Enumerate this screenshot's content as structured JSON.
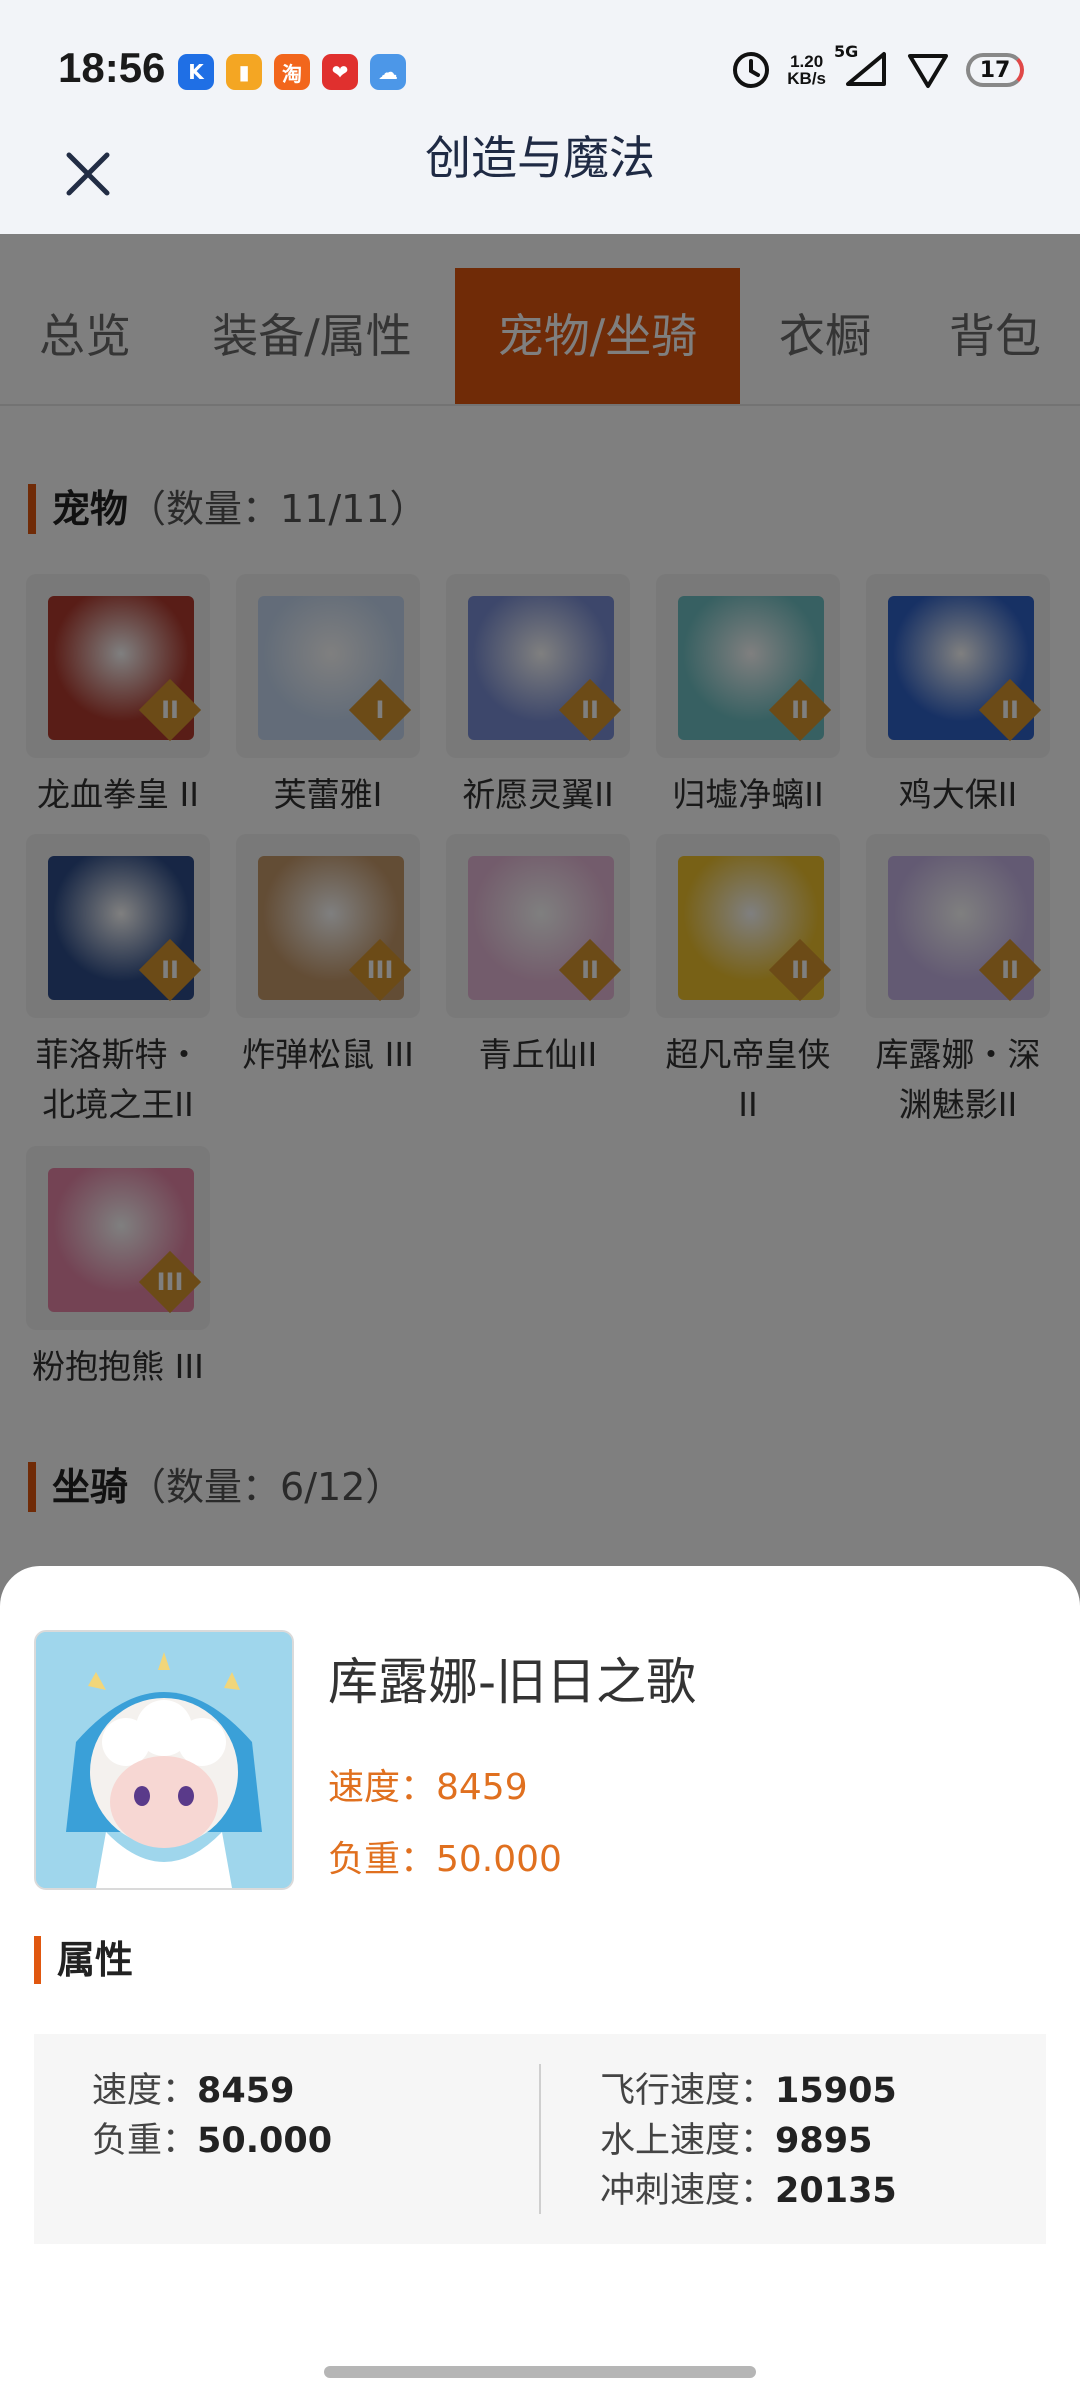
{
  "status_bar": {
    "time": "18:56",
    "app_icons": [
      {
        "name": "k-app-icon",
        "glyph": "K",
        "color": "#1f6fe5"
      },
      {
        "name": "notes-app-icon",
        "glyph": "▮",
        "color": "#f4a623"
      },
      {
        "name": "taobao-app-icon",
        "glyph": "淘",
        "color": "#f2661c"
      },
      {
        "name": "heart-app-icon",
        "glyph": "❤",
        "color": "#e0302e"
      },
      {
        "name": "weather-app-icon",
        "glyph": "☁",
        "color": "#4c97e8"
      }
    ],
    "net_speed_value": "1.20",
    "net_speed_unit": "KB/s",
    "network_type": "5G",
    "battery": "17"
  },
  "app_bar": {
    "title": "创造与魔法"
  },
  "tabs": [
    {
      "label": "总览",
      "active": false
    },
    {
      "label": "装备/属性",
      "active": false
    },
    {
      "label": "宠物/坐骑",
      "active": true
    },
    {
      "label": "衣橱",
      "active": false
    },
    {
      "label": "背包",
      "active": false
    }
  ],
  "pets_section": {
    "title": "宠物",
    "count": "（数量：11/11）",
    "items": [
      {
        "name": "龙血拳皇 II",
        "tier": "II",
        "art": "#b23a2e"
      },
      {
        "name": "芙蕾雅I",
        "tier": "I",
        "art": "#c6d9f2"
      },
      {
        "name": "祈愿灵翼II",
        "tier": "II",
        "art": "#7b8fd6"
      },
      {
        "name": "归墟净螭II",
        "tier": "II",
        "art": "#6fc1c4"
      },
      {
        "name": "鸡大保II",
        "tier": "II",
        "art": "#2f62c9"
      },
      {
        "name": "菲洛斯特・北境之王II",
        "tier": "II",
        "art": "#2e4d8a"
      },
      {
        "name": "炸弹松鼠 III",
        "tier": "III",
        "art": "#c79a6b"
      },
      {
        "name": "青丘仙II",
        "tier": "II",
        "art": "#e7b9d8"
      },
      {
        "name": "超凡帝皇侠 II",
        "tier": "II",
        "art": "#f0c22c"
      },
      {
        "name": "库露娜・深渊魅影II",
        "tier": "II",
        "art": "#c6b4e6"
      },
      {
        "name": "粉抱抱熊 III",
        "tier": "III",
        "art": "#e886a8"
      }
    ]
  },
  "mounts_section": {
    "title": "坐骑",
    "count": "（数量：6/12）"
  },
  "detail_sheet": {
    "name": "库露娜-旧日之歌",
    "stat_speed": "速度：8459",
    "stat_load": "负重：50.000",
    "section_title": "属性",
    "attributes_left": [
      {
        "label": "速度：",
        "value": "8459"
      },
      {
        "label": "负重：",
        "value": "50.000"
      }
    ],
    "attributes_right": [
      {
        "label": "飞行速度：",
        "value": "15905"
      },
      {
        "label": "水上速度：",
        "value": "9895"
      },
      {
        "label": "冲刺速度：",
        "value": "20135"
      }
    ]
  },
  "colors": {
    "accent": "#e0570f",
    "stat_text": "#e0701f"
  }
}
